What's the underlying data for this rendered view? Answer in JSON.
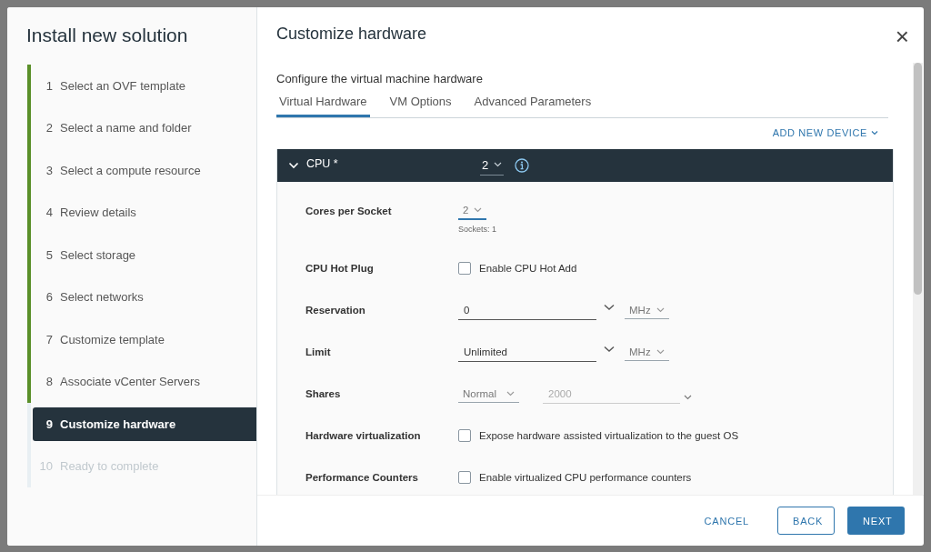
{
  "wizard": {
    "title": "Install new solution",
    "steps": [
      {
        "number": "1",
        "label": "Select an OVF template",
        "completed": true,
        "selected": false
      },
      {
        "number": "2",
        "label": "Select a name and folder",
        "completed": true,
        "selected": false
      },
      {
        "number": "3",
        "label": "Select a compute resource",
        "completed": true,
        "selected": false
      },
      {
        "number": "4",
        "label": "Review details",
        "completed": true,
        "selected": false
      },
      {
        "number": "5",
        "label": "Select storage",
        "completed": true,
        "selected": false
      },
      {
        "number": "6",
        "label": "Select networks",
        "completed": true,
        "selected": false
      },
      {
        "number": "7",
        "label": "Customize template",
        "completed": true,
        "selected": false
      },
      {
        "number": "8",
        "label": "Associate vCenter Servers",
        "completed": true,
        "selected": false
      },
      {
        "number": "9",
        "label": "Customize hardware",
        "completed": false,
        "selected": true
      },
      {
        "number": "10",
        "label": "Ready to complete",
        "completed": false,
        "selected": false
      }
    ]
  },
  "page": {
    "title": "Customize hardware",
    "close": "×",
    "subtitle": "Configure the virtual machine hardware",
    "tabs": [
      {
        "label": "Virtual Hardware",
        "selected": true
      },
      {
        "label": "VM Options",
        "selected": false
      },
      {
        "label": "Advanced Parameters",
        "selected": false
      }
    ],
    "add_device": "ADD NEW DEVICE",
    "cpu": {
      "label": "CPU *",
      "value": "2",
      "expanded": true,
      "rows": [
        {
          "kind": "select",
          "label": "Cores per Socket",
          "value": "2",
          "hint": "Sockets: 1"
        },
        {
          "kind": "checkbox",
          "label": "CPU Hot Plug",
          "option": "Enable CPU Hot Add",
          "checked": false
        },
        {
          "kind": "amount",
          "label": "Reservation",
          "value": "0",
          "unit": "MHz"
        },
        {
          "kind": "amount",
          "label": "Limit",
          "value": "Unlimited",
          "unit": "MHz"
        },
        {
          "kind": "shares",
          "label": "Shares",
          "preset": "Normal",
          "value": "2000",
          "disabled": true
        },
        {
          "kind": "checkbox",
          "label": "Hardware virtualization",
          "option": "Expose hardware assisted virtualization to the guest OS",
          "checked": false
        },
        {
          "kind": "checkbox",
          "label": "Performance Counters",
          "option": "Enable virtualized CPU performance counters",
          "checked": false
        }
      ]
    }
  },
  "buttons": [
    {
      "label": "CANCEL",
      "kind": "flat"
    },
    {
      "label": "BACK",
      "kind": "outline"
    },
    {
      "label": "NEXT",
      "kind": "primary"
    }
  ]
}
